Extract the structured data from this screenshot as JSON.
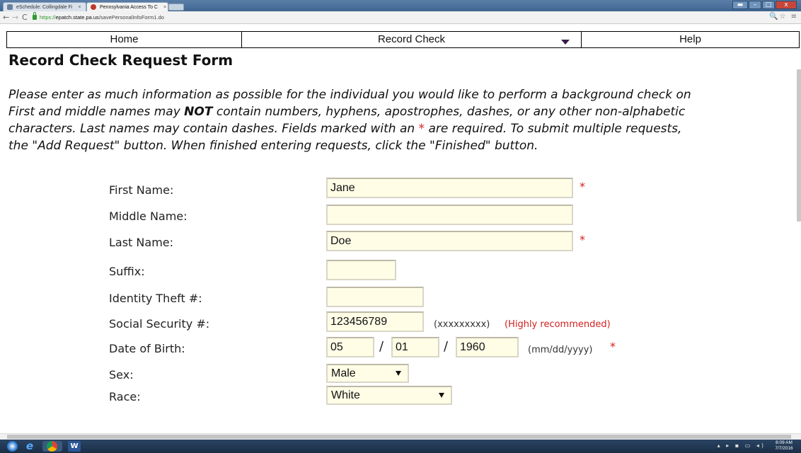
{
  "browser": {
    "tabs": [
      {
        "label": "eSchedule: Collingdale Fi",
        "close": "×",
        "favicon_color": "#6a7f99"
      },
      {
        "label": "Pennsylvania Access To C",
        "close": "×",
        "favicon_color": "#c0392b"
      }
    ],
    "nav": {
      "back": "←",
      "forward": "→",
      "reload": "C"
    },
    "url": {
      "scheme": "https://",
      "domain": "epatch.state.pa.us",
      "path": "/savePersonalInfoForm1.do"
    },
    "toolbar_icons": "🔍☆ ≡",
    "window_controls": {
      "profile": "▬",
      "minimize": "–",
      "maximize": "□",
      "close": "x"
    }
  },
  "site_nav": {
    "home": "Home",
    "record_check": "Record Check",
    "help": "Help"
  },
  "page": {
    "title": "Record Check Request Form",
    "instructions": {
      "line1": "Please enter as much information as possible for the individual you would like to perform a background check on",
      "line2_before": "First and middle names may ",
      "line2_bold": "NOT",
      "line2_after": " contain numbers, hyphens, apostrophes, dashes, or any other non-alphabetic",
      "line3_before": "characters. Last names may contain dashes. Fields marked with an ",
      "line3_star": "*",
      "line3_after": " are required. To submit multiple requests,",
      "line4": "the \"Add Request\" button. When finished entering requests, click the \"Finished\" button."
    }
  },
  "form": {
    "first_name": {
      "label": "First Name:",
      "value": "Jane",
      "required_mark": "*"
    },
    "middle_name": {
      "label": "Middle Name:",
      "value": ""
    },
    "last_name": {
      "label": "Last Name:",
      "value": "Doe",
      "required_mark": "*"
    },
    "suffix": {
      "label": "Suffix:",
      "value": ""
    },
    "identity_theft": {
      "label": "Identity Theft #:",
      "value": ""
    },
    "ssn": {
      "label": "Social Security #:",
      "value": "123456789",
      "format_hint": "(xxxxxxxxx)",
      "recommend_hint": "(Highly recommended)"
    },
    "dob": {
      "label": "Date of Birth:",
      "month": "05",
      "day": "01",
      "year": "1960",
      "separator": "/",
      "format_hint": "(mm/dd/yyyy)",
      "required_mark": "*"
    },
    "sex": {
      "label": "Sex:",
      "value": "Male"
    },
    "race": {
      "label": "Race:",
      "value": "White"
    }
  },
  "taskbar": {
    "word_label": "W",
    "ie_label": "e",
    "tray": "▴ ▸ ▪ ▭ ◂)",
    "clock_time": "8:09 AM",
    "clock_date": "7/7/2016"
  }
}
